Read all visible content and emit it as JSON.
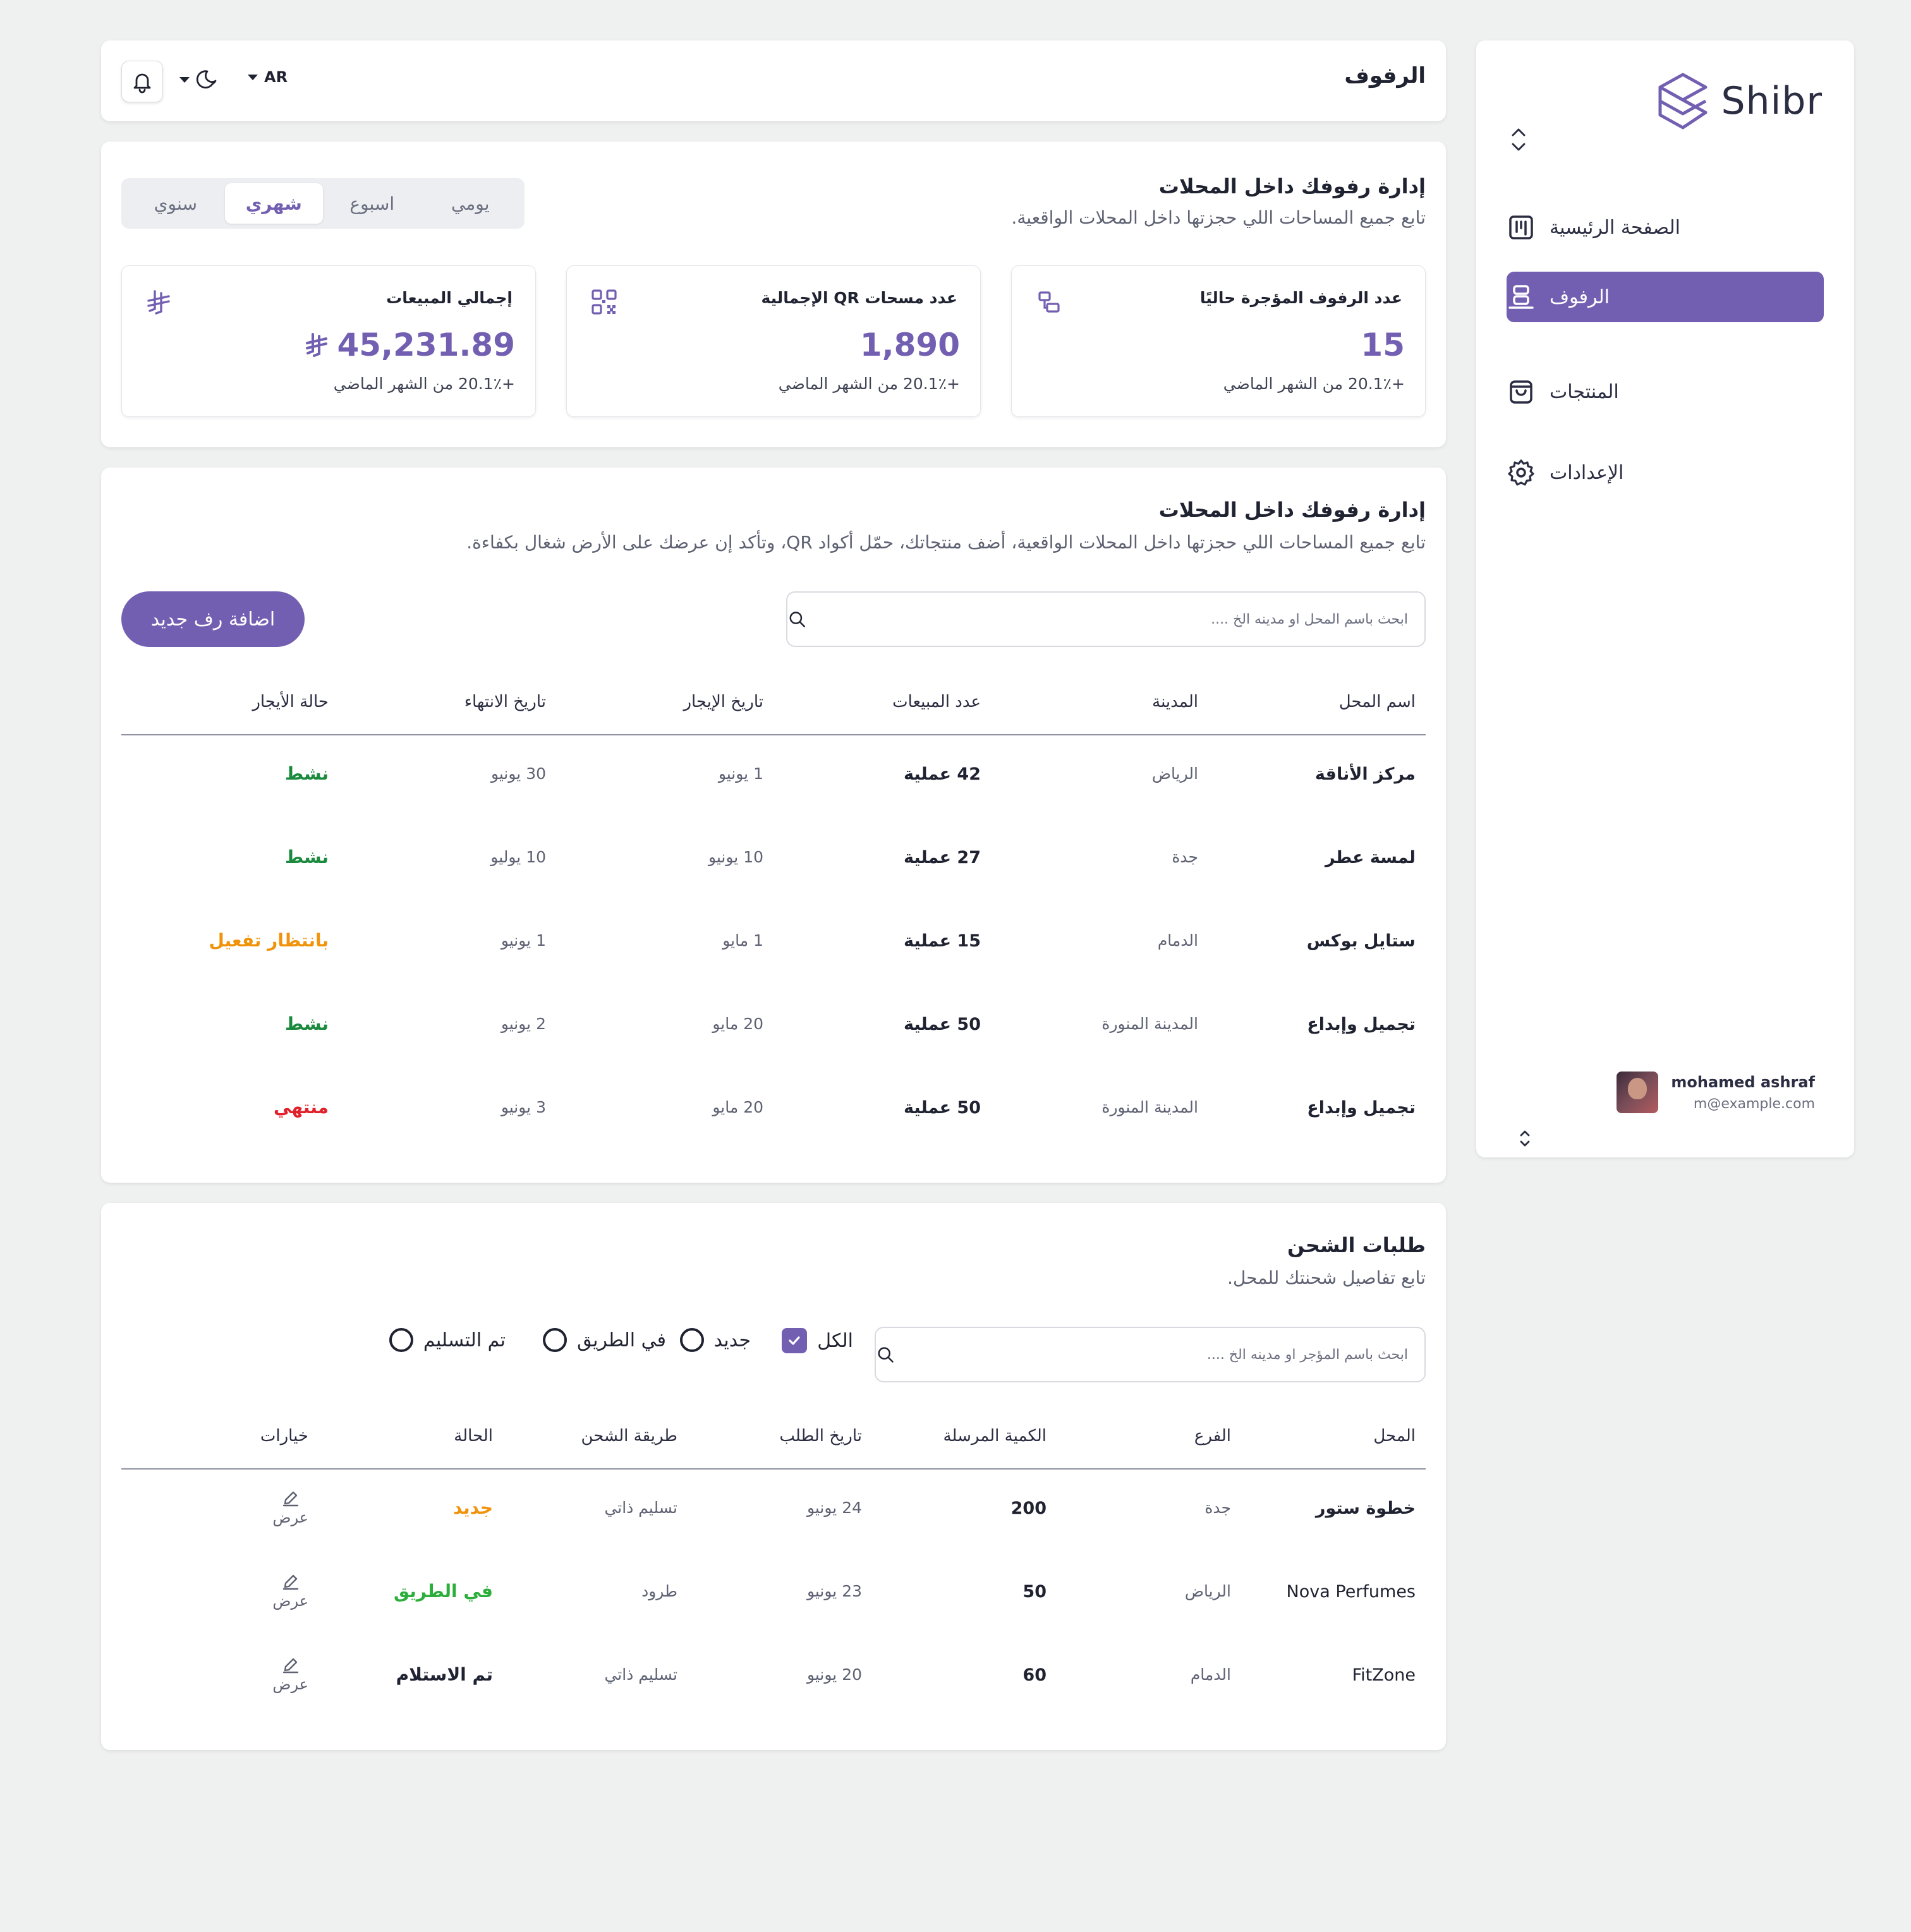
{
  "sidebar": {
    "brand": "Shibr",
    "nav": [
      {
        "label": "الصفحة الرئيسية",
        "icon": "kanban-icon"
      },
      {
        "label": "الرفوف",
        "icon": "shelf-icon",
        "active": true
      },
      {
        "label": "المنتجات",
        "icon": "shopping-bag-icon"
      },
      {
        "label": "الإعدادات",
        "icon": "gear-icon"
      }
    ],
    "user": {
      "name": "mohamed ashraf",
      "email": "m@example.com"
    }
  },
  "header": {
    "title": "الرفوف",
    "language": "AR",
    "theme_icon": "moon-icon",
    "notification_icon": "bell-icon"
  },
  "stats": {
    "title": "إدارة رفوفك داخل المحلات",
    "subtitle": "تابع جميع المساحات اللي حجزتها داخل المحلات الواقعية.",
    "periods": [
      {
        "label": "سنوي"
      },
      {
        "label": "شهري",
        "active": true
      },
      {
        "label": "اسبوع"
      },
      {
        "label": "يومي"
      }
    ],
    "cards": [
      {
        "title": "عدد الرفوف المؤجرة حاليًا",
        "value": "15",
        "change": "+20.1٪ من الشهر الماضي",
        "icon": "shelves-icon"
      },
      {
        "title": "عدد مسحات QR الإجمالية",
        "value": "1,890",
        "change": "+20.1٪ من الشهر الماضي",
        "icon": "qr-code-icon"
      },
      {
        "title": "إجمالي المبيعات",
        "value": "45,231.89",
        "change": "+20.1٪ من الشهر الماضي",
        "icon": "riyal-icon"
      }
    ]
  },
  "shelves": {
    "title": "إدارة رفوفك داخل المحلات",
    "subtitle": "تابع جميع المساحات اللي حجزتها داخل المحلات الواقعية، أضف منتجاتك، حمّل أكواد QR، وتأكد إن عرضك على الأرض شغال بكفاءة.",
    "search_placeholder": "ابحث باسم المحل او مدينه الخ ....",
    "add_button": "اضافة رف جديد",
    "columns": [
      "اسم المحل",
      "المدينة",
      "عدد المبيعات",
      "تاريخ الإيجار",
      "تاريخ الانتهاء",
      "حالة الأيجار"
    ],
    "rows": [
      {
        "store": "مركز الأناقة",
        "city": "الرياض",
        "sales": "42 عملية",
        "rent_date": "1 يونيو",
        "end_date": "30 يونيو",
        "status": "نشط",
        "status_type": "active"
      },
      {
        "store": "لمسة عطر",
        "city": "جدة",
        "sales": "27 عملية",
        "rent_date": "10 يونيو",
        "end_date": "10 يوليو",
        "status": "نشط",
        "status_type": "active"
      },
      {
        "store": "ستايل بوكس",
        "city": "الدمام",
        "sales": "15 عملية",
        "rent_date": "1 مايو",
        "end_date": "1 يونيو",
        "status": "بانتظار تفعيل",
        "status_type": "pending"
      },
      {
        "store": "تجميل وإبداع",
        "city": "المدينة المنورة",
        "sales": "50 عملية",
        "rent_date": "20 مايو",
        "end_date": "2 يونيو",
        "status": "نشط",
        "status_type": "active"
      },
      {
        "store": "تجميل وإبداع",
        "city": "المدينة المنورة",
        "sales": "50 عملية",
        "rent_date": "20 مايو",
        "end_date": "3 يونيو",
        "status": "منتهي",
        "status_type": "ended"
      }
    ]
  },
  "shipping": {
    "title": "طلبات الشحن",
    "subtitle": "تابع تفاصيل شحنتك للمحل.",
    "search_placeholder": "ابحث باسم المؤجر او مدينه الخ ....",
    "filters": [
      {
        "label": "الكل",
        "checked": true
      },
      {
        "label": "جديد",
        "checked": false
      },
      {
        "label": "في الطريق",
        "checked": false
      },
      {
        "label": "تم التسليم",
        "checked": false
      }
    ],
    "columns": [
      "المحل",
      "الفرع",
      "الكمية  المرسلة",
      "تاريخ الطلب",
      "طريقة الشحن",
      "الحالة",
      "خيارات"
    ],
    "rows": [
      {
        "store": "خطوة ستور",
        "branch": "جدة",
        "qty": "200",
        "date": "24 يونيو",
        "method": "تسليم ذاتي",
        "status": "جديد",
        "status_type": "new",
        "action": "عرض"
      },
      {
        "store": "Nova Perfumes",
        "branch": "الرياض",
        "qty": "50",
        "date": "23 يونيو",
        "method": "طرود",
        "status": "في الطريق",
        "status_type": "onway",
        "action": "عرض"
      },
      {
        "store": "FitZone",
        "branch": "الدمام",
        "qty": "60",
        "date": "20 يونيو",
        "method": "تسليم ذاتي",
        "status": "تم الاستلام",
        "status_type": "done",
        "action": "عرض"
      }
    ]
  },
  "colors": {
    "accent": "#735fb1",
    "active": "#1a8a3d",
    "pending": "#f0930b",
    "ended": "#e0202a",
    "onway": "#2cae3b",
    "background": "#eff0f0"
  }
}
